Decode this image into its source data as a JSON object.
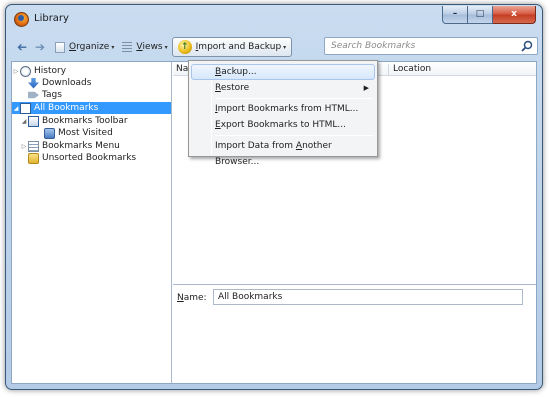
{
  "window": {
    "title": "Library",
    "buttons": {
      "minimize": "–",
      "maximize": "□",
      "close": "x"
    }
  },
  "toolbar": {
    "back_icon": "back-arrow-icon",
    "forward_icon": "forward-arrow-icon",
    "organize_prefix": "",
    "organize_underline": "O",
    "organize_rest": "rganize",
    "views_underline": "V",
    "views_rest": "iews",
    "import_backup_underline": "I",
    "import_backup_rest": "mport and Backup",
    "dropdown_glyph": "▾",
    "search_placeholder": "Search Bookmarks"
  },
  "tree": {
    "items": [
      {
        "label": "History",
        "icon": "history-icon",
        "twisty": "▷"
      },
      {
        "label": "Downloads",
        "icon": "downloads-icon",
        "twisty": ""
      },
      {
        "label": "Tags",
        "icon": "tags-icon",
        "twisty": ""
      },
      {
        "label": "All Bookmarks",
        "icon": "all-bookmarks-icon",
        "twisty": "◢",
        "selected": true
      },
      {
        "label": "Bookmarks Toolbar",
        "icon": "bookmarks-toolbar-icon",
        "twisty": "◢"
      },
      {
        "label": "Most Visited",
        "icon": "most-visited-icon",
        "twisty": ""
      },
      {
        "label": "Bookmarks Menu",
        "icon": "bookmarks-menu-icon",
        "twisty": "▷"
      },
      {
        "label": "Unsorted Bookmarks",
        "icon": "unsorted-bookmarks-icon",
        "twisty": ""
      }
    ]
  },
  "list": {
    "columns": [
      "Na",
      "Location"
    ]
  },
  "details": {
    "name_label_underline": "N",
    "name_label_rest": "ame:",
    "name_value": "All Bookmarks"
  },
  "menu": {
    "items": [
      {
        "underline": "B",
        "rest": "ackup...",
        "pre": ""
      },
      {
        "underline": "R",
        "rest": "estore",
        "pre": "",
        "submenu": "▶"
      },
      {
        "pre": "",
        "underline": "I",
        "rest": "mport Bookmarks from HTML..."
      },
      {
        "pre": "",
        "underline": "E",
        "rest": "xport Bookmarks to HTML..."
      },
      {
        "pre": "Import Data from ",
        "underline": "A",
        "rest": "nother Browser..."
      }
    ]
  },
  "colors": {
    "selection": "#3399ff",
    "title_bar": "#b3cbe6",
    "close_button": "#c33c22"
  }
}
